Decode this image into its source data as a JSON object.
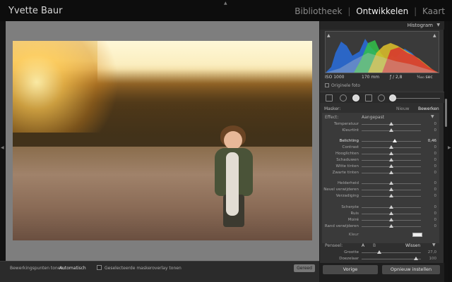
{
  "window": {
    "owner": "Yvette Baur"
  },
  "modules": {
    "library": "Bibliotheek",
    "develop": "Ontwikkelen",
    "map": "Kaart",
    "sep": "|"
  },
  "histogram": {
    "title": "Histogram",
    "iso": "ISO 1000",
    "focal": "170 mm",
    "aperture": "ƒ / 2,8",
    "shutter": "¹⁄₄₀₀ sec",
    "original_photo": "Originele foto"
  },
  "mask": {
    "label": "Masker:",
    "new": "Nieuw",
    "edit": "Bewerken"
  },
  "effect": {
    "label": "Effect:",
    "value": "Aangepast"
  },
  "sliders": [
    {
      "label": "Temperatuur",
      "value": "0",
      "pos": 0.5
    },
    {
      "label": "Kleurtint",
      "value": "0",
      "pos": 0.5
    },
    {
      "label": "Belichting",
      "value": "0,46",
      "pos": 0.56,
      "highlight": true
    },
    {
      "label": "Contrast",
      "value": "0",
      "pos": 0.5
    },
    {
      "label": "Hooglichten",
      "value": "0",
      "pos": 0.5
    },
    {
      "label": "Schaduwen",
      "value": "0",
      "pos": 0.5
    },
    {
      "label": "Witte tinten",
      "value": "0",
      "pos": 0.5
    },
    {
      "label": "Zwarte tinten",
      "value": "0",
      "pos": 0.5
    },
    {
      "label": "Helderheid",
      "value": "0",
      "pos": 0.5
    },
    {
      "label": "Nevel verwijderen",
      "value": "0",
      "pos": 0.5
    },
    {
      "label": "Verzadiging",
      "value": "0",
      "pos": 0.5
    },
    {
      "label": "Scherpte",
      "value": "0",
      "pos": 0.5
    },
    {
      "label": "Ruis",
      "value": "0",
      "pos": 0.5
    },
    {
      "label": "Moiré",
      "value": "0",
      "pos": 0.5
    },
    {
      "label": "Rand verwijderen",
      "value": "0",
      "pos": 0.5
    }
  ],
  "color": {
    "label": "Kleur"
  },
  "brush": {
    "label": "Penseel:",
    "a": "A",
    "b": "B",
    "clear": "Wissen"
  },
  "brush_sliders": [
    {
      "label": "Grootte",
      "value": "27,0",
      "pos": 0.3
    },
    {
      "label": "Doezelaar",
      "value": "100",
      "pos": 0.92
    }
  ],
  "toolbar": {
    "pins_label": "Bewerkingspunten tonen:",
    "pins_value": "Automatisch",
    "overlay_label": "Geselecteerde maskeroverlay tonen",
    "done": "Gereed"
  },
  "buttons": {
    "previous": "Vorige",
    "reset": "Opnieuw instellen"
  },
  "colors": {
    "panel": "#2f2f2f",
    "topbar": "#0d0d0d",
    "canvas": "#7e7e7e"
  }
}
